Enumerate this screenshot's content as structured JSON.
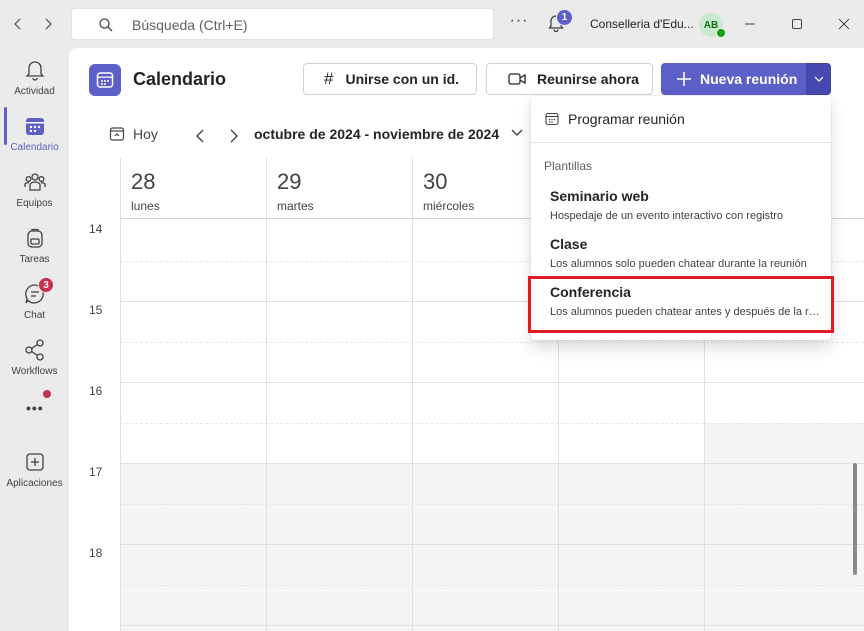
{
  "titlebar": {
    "search_placeholder": "Búsqueda (Ctrl+E)",
    "more_label": "···",
    "notification_count": "1",
    "org_name": "Conselleria d'Edu...",
    "avatar_initials": "AB"
  },
  "rail": {
    "items": [
      {
        "label": "Actividad",
        "icon": "bell-icon"
      },
      {
        "label": "Calendario",
        "icon": "calendar-icon"
      },
      {
        "label": "Equipos",
        "icon": "teams-icon"
      },
      {
        "label": "Tareas",
        "icon": "backpack-icon"
      },
      {
        "label": "Chat",
        "icon": "chat-icon"
      },
      {
        "label": "Workflows",
        "icon": "workflow-icon"
      },
      {
        "label": "Aplicaciones",
        "icon": "add-app-icon"
      }
    ],
    "chat_badge": "3",
    "more_label": "•••"
  },
  "header": {
    "title": "Calendario",
    "join_label": "Unirse con un id.",
    "meet_label": "Reunirse ahora",
    "new_meeting_label": "Nueva reunión"
  },
  "toolbar": {
    "today_label": "Hoy",
    "range_label": "octubre de 2024 - noviembre de 2024"
  },
  "calendar": {
    "columns": [
      {
        "num": "28",
        "day": "lunes"
      },
      {
        "num": "29",
        "day": "martes"
      },
      {
        "num": "30",
        "day": "miércoles"
      }
    ],
    "hours": [
      "14",
      "15",
      "16",
      "17",
      "18"
    ]
  },
  "dropdown": {
    "schedule_label": "Programar reunión",
    "section_label": "Plantillas",
    "items": [
      {
        "title": "Seminario web",
        "desc": "Hospedaje de un evento interactivo con registro"
      },
      {
        "title": "Clase",
        "desc": "Los alumnos solo pueden chatear durante la reunión"
      },
      {
        "title": "Conferencia",
        "desc": "Los alumnos pueden chatear antes y después de la reunión"
      }
    ]
  },
  "colors": {
    "accent": "#5b5fc7",
    "highlight": "#e01b24",
    "chat_badge": "#c4314b"
  }
}
